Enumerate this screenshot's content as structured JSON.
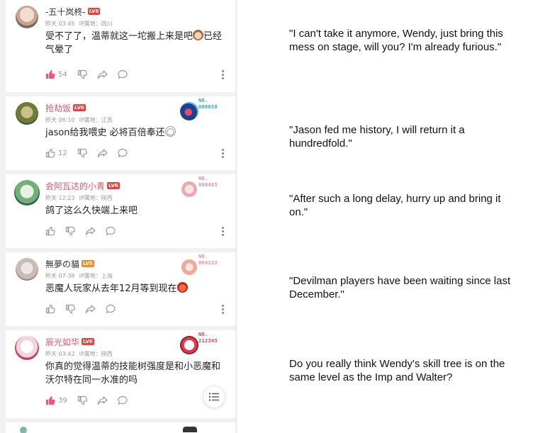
{
  "colors": {
    "accent_pink": "#ff4e7a",
    "username_red": "#e0556a",
    "lv6": "#e8413c",
    "lv5": "#f08c2a",
    "badge_blue": "#2aa6b8",
    "badge_pink": "#e98b97",
    "badge_red": "#e43a4d"
  },
  "comments": [
    {
      "username": "-五十岚柊-",
      "level": "LV6",
      "time": "昨天 03:45",
      "ip_label": "IP属地：四川",
      "text": "受不了了，温蒂就这一坨搬上来是吧",
      "text_tail": "已经气晕了",
      "likes": "54",
      "liked": true,
      "avatar_icon": "anime-girl-avatar"
    },
    {
      "username": "抢劫饭",
      "level": "LV6",
      "time": "昨天 06:10",
      "ip_label": "IP属地：江苏",
      "text": "jason给我喂史 必将百倍奉还",
      "likes": "12",
      "liked": false,
      "badge_no": "NO.",
      "badge_num": "000058",
      "avatar_icon": "leaf-character-avatar"
    },
    {
      "username": "会阿瓦达的小青",
      "level": "LV6",
      "time": "昨天 12:23",
      "ip_label": "IP属地：陕西",
      "text": "鸽了这么久快端上来吧",
      "badge_no": "NO.",
      "badge_num": "000485",
      "avatar_icon": "green-character-avatar"
    },
    {
      "username": "無夢の貓",
      "level": "LV5",
      "time": "昨天 07:38",
      "ip_label": "IP属地：上海",
      "text": "恶魔人玩家从去年12月等到现在",
      "badge_no": "NO.",
      "badge_num": "004152",
      "avatar_icon": "cat-avatar"
    },
    {
      "username": "辰光如华",
      "level": "LV6",
      "time": "昨天 03:42",
      "ip_label": "IP属地：陕西",
      "text": "你真的觉得温蒂的技能树强度是和小恶魔和沃尔特在同一水准的吗",
      "likes": "39",
      "liked": true,
      "badge_no": "NO.",
      "badge_num": "212345",
      "avatar_icon": "white-hair-girl-avatar"
    }
  ],
  "translations": [
    "\"I can't take it anymore, Wendy, just bring this mess on stage, will you? I'm already furious.\"",
    "\"Jason fed me history, I will return it a hundredfold.\"",
    "\"After such a long delay, hurry up and bring it on.\"",
    "\"Devilman players have been waiting since last December.\"",
    "Do you really think Wendy's skill tree is on the same level as the Imp and Walter?"
  ]
}
